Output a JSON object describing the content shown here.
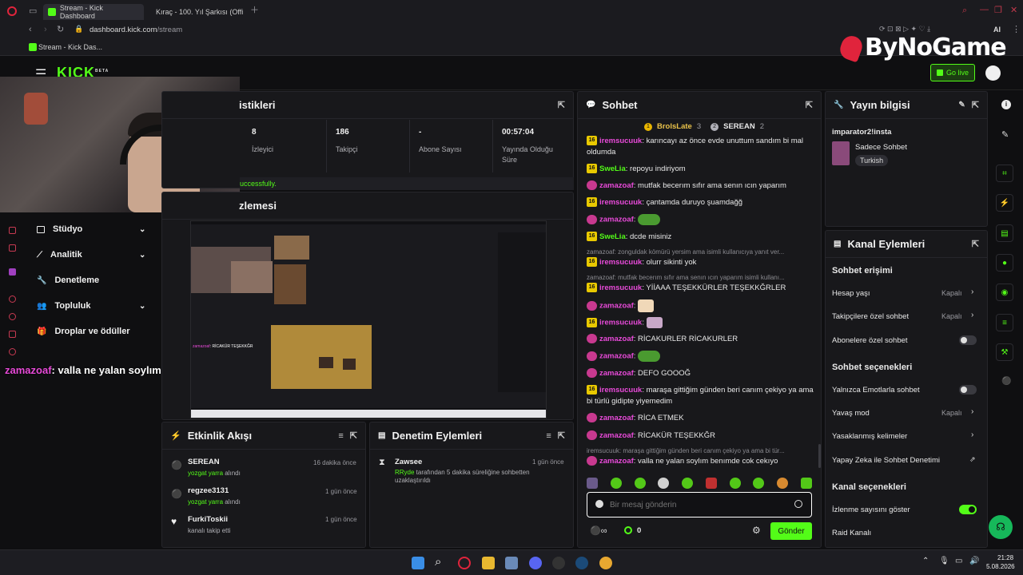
{
  "browser": {
    "tabs": [
      {
        "label": "Stream - Kick Dashboard",
        "active": true
      },
      {
        "label": "Kıraç - 100. Yıl Şarkısı (Offi",
        "active": false
      }
    ],
    "url_domain": "dashboard.kick.com",
    "url_path": "/stream",
    "bookmark": "Stream - Kick Das...",
    "ai_label": "AI"
  },
  "overlay": {
    "brand": "ByNoGame",
    "chat_message_user": "zamazoaf",
    "chat_message_text": ": valla ne yalan soylım benımde cok cekıyo"
  },
  "header": {
    "logo": "KICK",
    "logo_tag": "BETA",
    "go_live": "Go live"
  },
  "sidebar": {
    "items": [
      {
        "label": "Stüdyo",
        "expandable": true
      },
      {
        "label": "Analitik",
        "expandable": true
      },
      {
        "label": "Denetleme",
        "expandable": false
      },
      {
        "label": "Topluluk",
        "expandable": true
      },
      {
        "label": "Droplar ve ödüller",
        "expandable": false
      }
    ]
  },
  "stats": {
    "title_partial": "istikleri",
    "success_partial": "uccessfully.",
    "items": [
      {
        "value": "8",
        "label": "İzleyici"
      },
      {
        "value": "186",
        "label": "Takipçi"
      },
      {
        "value": "-",
        "label": "Abone Sayısı"
      },
      {
        "value": "00:57:04",
        "label": "Yayında Olduğu Süre"
      }
    ]
  },
  "preview": {
    "title_partial": "zlemesi"
  },
  "activity": {
    "title": "Etkinlik Akışı",
    "items": [
      {
        "name": "SEREAN",
        "sub_green": "yozgat yarra",
        "sub": " alındı",
        "time": "16 dakika önce"
      },
      {
        "name": "regzee3131",
        "sub_green": "yozgat yarra",
        "sub": " alındı",
        "time": "1 gün önce"
      },
      {
        "name": "FurkiToskii",
        "sub_green": "",
        "sub": "kanalı takip etti",
        "time": "1 gün önce"
      }
    ]
  },
  "moderation": {
    "title": "Denetim Eylemleri",
    "items": [
      {
        "name": "Zawsee",
        "actor": "RRyde",
        "text": " tarafından 5 dakika süreliğine sohbetten uzaklaştırıldı",
        "time": "1 gün önce"
      }
    ]
  },
  "chat": {
    "title": "Sohbet",
    "top": [
      {
        "rank": "1",
        "name": "BrolsLate",
        "count": "3"
      },
      {
        "rank": "2",
        "name": "SEREAN",
        "count": "2"
      }
    ],
    "messages": [
      {
        "badge": "16",
        "user": "iremsucuuk",
        "color": "green",
        "text": ": karıncayı az önce evde unuttum sandım bi mal oldumda"
      },
      {
        "badge": "16",
        "user": "SweLia",
        "color": "green",
        "text": ": repoyu indiriyom"
      },
      {
        "badge": "z",
        "user": "zamazoaf",
        "color": "pink",
        "text": ": mutfak becerım sıfır ama senın ıcın yaparım"
      },
      {
        "badge": "16",
        "user": "iremsucuuk",
        "color": "green",
        "text": ": çantamda duruyo şuamdağğ"
      },
      {
        "badge": "z",
        "user": "zamazoaf",
        "color": "pink",
        "text": ":"
      },
      {
        "badge": "16",
        "user": "SweLia",
        "color": "green",
        "text": ": dcde misiniz"
      },
      {
        "reply": "zamazoaf: zonguldak kömürü yersim ama isimli kullanıcıya yanıt ver..."
      },
      {
        "badge": "16",
        "user": "iremsucuuk",
        "color": "green",
        "text": ": olurr sikinti yok"
      },
      {
        "reply": "zamazoaf: mutfak becerım sıfır ama senın ıcın yaparım isimli kullanı..."
      },
      {
        "badge": "16",
        "user": "iremsucuuk",
        "color": "green",
        "text": ": YİİAAA TEŞEKKÜRLER TEŞEKKĞRLER"
      },
      {
        "badge": "z",
        "user": "zamazoaf",
        "color": "pink",
        "text": ":"
      },
      {
        "badge": "16",
        "user": "iremsucuuk",
        "color": "green",
        "text": ":"
      },
      {
        "badge": "z",
        "user": "zamazoaf",
        "color": "pink",
        "text": ": RİCAKURLER RİCAKURLER"
      },
      {
        "badge": "z",
        "user": "zamazoaf",
        "color": "pink",
        "text": ":"
      },
      {
        "badge": "z",
        "user": "zamazoaf",
        "color": "pink",
        "text": ": DEFO GOOOĞ"
      },
      {
        "badge": "16",
        "user": "iremsucuuk",
        "color": "green",
        "text": ": maraşa gittiğim günden beri canım çekiyo ya ama bi türlü gidipte yiyemedim"
      },
      {
        "badge": "z",
        "user": "zamazoaf",
        "color": "pink",
        "text": ": RİCA ETMEK"
      },
      {
        "badge": "z",
        "user": "zamazoaf",
        "color": "pink",
        "text": ": RİCAKÜR TEŞEKKĞR"
      },
      {
        "reply": "iremsucuuk: maraşa gittiğim günden beri canım çekiyo ya ama bi tür..."
      },
      {
        "badge": "z",
        "user": "zamazoaf",
        "color": "pink",
        "text": ": valla ne yalan soylım benımde cok cekıyo"
      }
    ],
    "input_placeholder": "Bir mesaj gönderin",
    "points": "0",
    "send": "Gönder"
  },
  "stream_info": {
    "title": "Yayın bilgisi",
    "stream_title": "imparator2!insta",
    "category": "Sadece Sohbet",
    "language": "Turkish"
  },
  "channel_actions": {
    "title": "Kanal Eylemleri",
    "chat_access_title": "Sohbet erişimi",
    "rows_access": [
      {
        "label": "Hesap yaşı",
        "value": "Kapalı",
        "kind": "chevron"
      },
      {
        "label": "Takipçilere özel sohbet",
        "value": "Kapalı",
        "kind": "chevron"
      },
      {
        "label": "Abonelere özel sohbet",
        "value": "",
        "kind": "toggle-off"
      }
    ],
    "chat_options_title": "Sohbet seçenekleri",
    "rows_options": [
      {
        "label": "Yalnızca Emotlarla sohbet",
        "value": "",
        "kind": "toggle-off"
      },
      {
        "label": "Yavaş mod",
        "value": "Kapalı",
        "kind": "chevron"
      },
      {
        "label": "Yasaklanmış kelimeler",
        "value": "",
        "kind": "chevron"
      },
      {
        "label": "Yapay Zeka ile Sohbet Denetimi",
        "value": "",
        "kind": "external"
      }
    ],
    "channel_options_title": "Kanal seçenekleri",
    "rows_channel": [
      {
        "label": "İzlenme sayısını göster",
        "value": "",
        "kind": "toggle-on"
      },
      {
        "label": "Raid Kanalı",
        "value": "",
        "kind": "none"
      }
    ]
  },
  "taskbar": {
    "time": "21:28",
    "date": "5.08.2026"
  },
  "colors": {
    "accent": "#53fc18",
    "pink": "#e84ad9",
    "panel": "#18181b",
    "bg": "#0f0f11"
  }
}
